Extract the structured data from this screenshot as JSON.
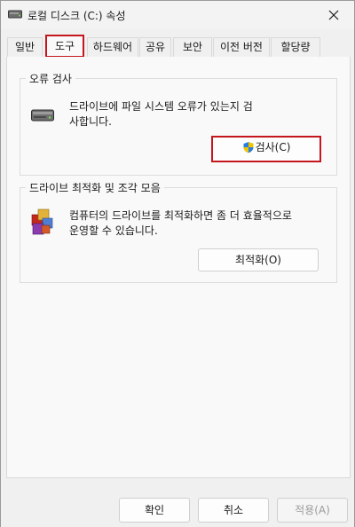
{
  "window": {
    "title": "로컬 디스크 (C:) 속성"
  },
  "tabs": [
    {
      "label": "일반"
    },
    {
      "label": "도구"
    },
    {
      "label": "하드웨어"
    },
    {
      "label": "공유"
    },
    {
      "label": "보안"
    },
    {
      "label": "이전 버전"
    },
    {
      "label": "할당량"
    }
  ],
  "active_tab": "도구",
  "error_check": {
    "title": "오류 검사",
    "desc_line1": "드라이브에 파일 시스템 오류가 있는지 검",
    "desc_line2": "사합니다.",
    "button_label": "검사(C)"
  },
  "optimize": {
    "title": "드라이브 최적화 및 조각 모음",
    "desc_line1": "컴퓨터의 드라이브를 최적화하면 좀 더 효율적으로",
    "desc_line2": "운영할 수 있습니다.",
    "button_label": "최적화(O)"
  },
  "footer": {
    "ok_label": "확인",
    "cancel_label": "취소",
    "apply_label": "적용(A)"
  },
  "colors": {
    "highlight": "#c4161c",
    "window_bg": "#f0f0f0",
    "panel_bg": "#f9f9f9"
  },
  "icons": {
    "title": "drive-icon",
    "close": "close-icon",
    "error_check": "hard-drive-icon",
    "scan_button": "uac-shield-icon",
    "optimize": "defrag-icon"
  }
}
